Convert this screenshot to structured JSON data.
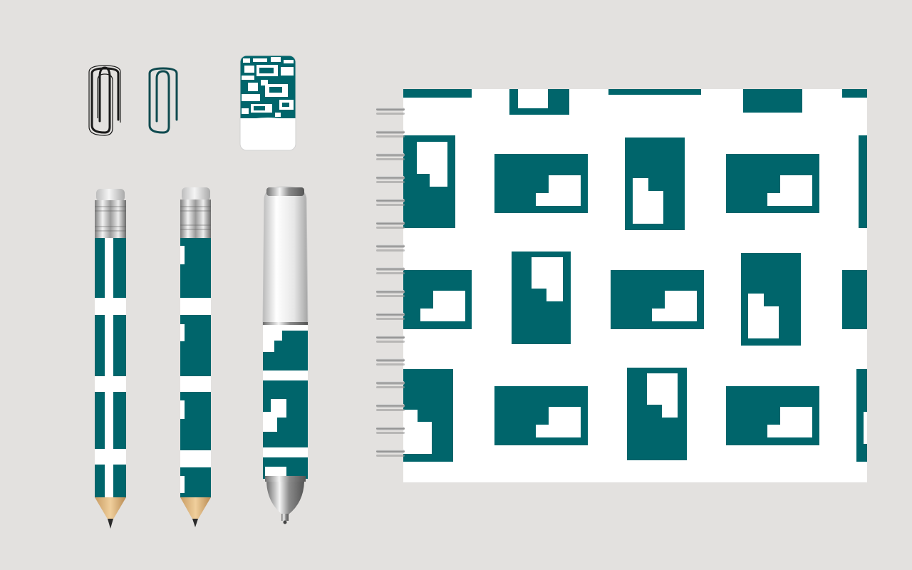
{
  "scene": {
    "background": "#e3e1df",
    "brand_color": "#00656b",
    "paper_color": "#ffffff"
  },
  "items": [
    {
      "name": "paper-clip-black",
      "icon": "paper-clip-icon",
      "color": "#1a1a1a"
    },
    {
      "name": "paper-clip-teal",
      "icon": "paper-clip-icon",
      "color": "#0f4a4f"
    },
    {
      "name": "eraser",
      "icon": "eraser-icon"
    },
    {
      "name": "pencil-stripes",
      "icon": "pencil-icon"
    },
    {
      "name": "pencil-blocks",
      "icon": "pencil-icon"
    },
    {
      "name": "ballpoint-pen",
      "icon": "pen-icon"
    },
    {
      "name": "spiral-notebook",
      "icon": "notebook-icon"
    }
  ]
}
